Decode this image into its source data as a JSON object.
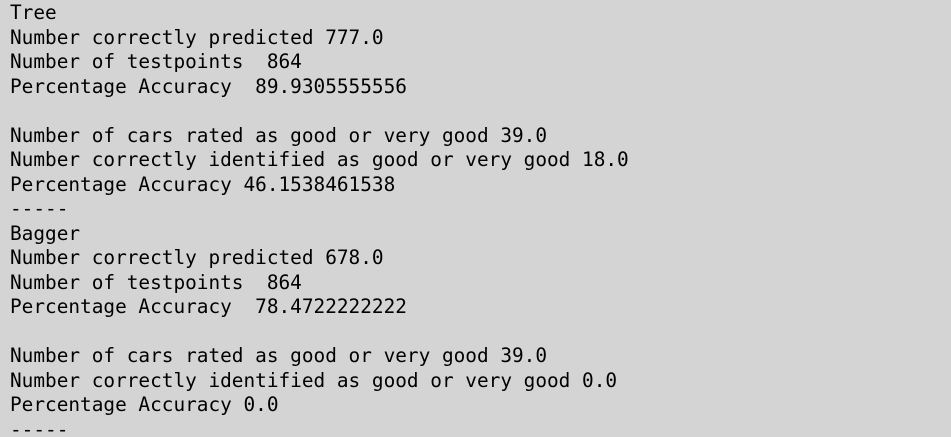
{
  "console": {
    "lines": [
      "Tree",
      "Number correctly predicted 777.0",
      "Number of testpoints  864",
      "Percentage Accuracy  89.9305555556",
      "",
      "Number of cars rated as good or very good 39.0",
      "Number correctly identified as good or very good 18.0",
      "Percentage Accuracy 46.1538461538",
      "-----",
      "Bagger",
      "Number correctly predicted 678.0",
      "Number of testpoints  864",
      "Percentage Accuracy  78.4722222222",
      "",
      "Number of cars rated as good or very good 39.0",
      "Number correctly identified as good or very good 0.0",
      "Percentage Accuracy 0.0",
      "-----"
    ]
  }
}
